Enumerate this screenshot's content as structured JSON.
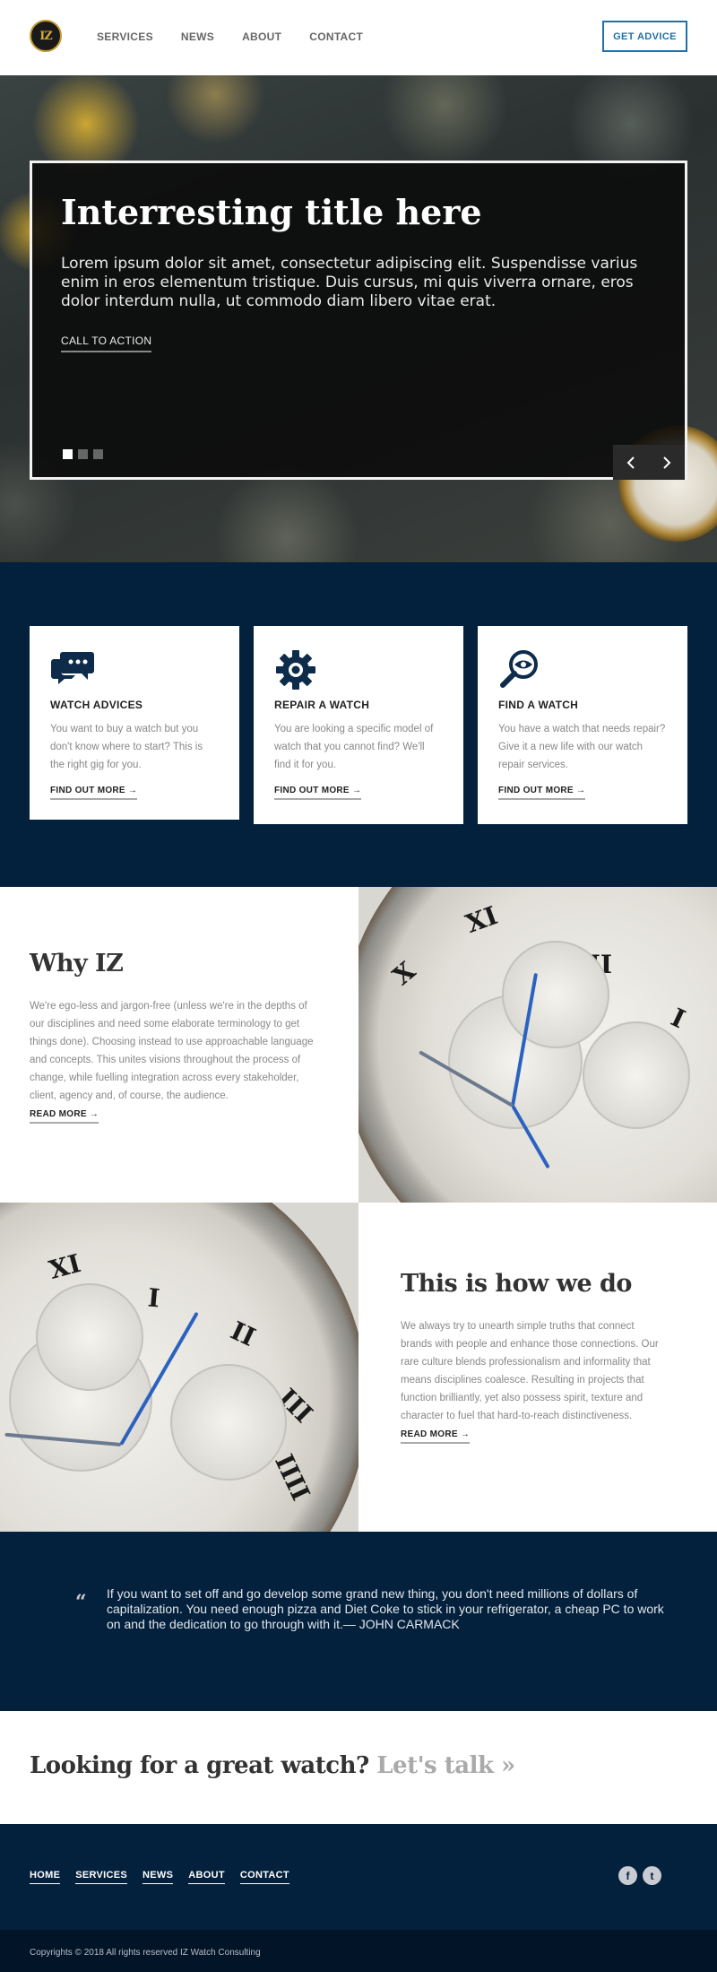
{
  "header": {
    "logo_text": "IZ",
    "nav": [
      "SERVICES",
      "NEWS",
      "ABOUT",
      "CONTACT"
    ],
    "cta": "GET ADVICE"
  },
  "hero": {
    "title": "Interresting title here",
    "text": "Lorem ipsum dolor sit amet, consectetur adipiscing elit. Suspendisse varius enim in eros elementum tristique. Duis cursus, mi quis viverra ornare, eros dolor interdum nulla, ut commodo diam libero vitae erat.",
    "cta": "CALL TO ACTION",
    "slides_total": 3,
    "active_slide": 1,
    "prev_icon": "chevron-left-icon",
    "next_icon": "chevron-right-icon"
  },
  "services": [
    {
      "icon": "chat-bubble-icon",
      "title": "WATCH ADVICES",
      "text": "You want to buy a watch but you don't know where to start? This is the right gig for you.",
      "link": "FIND OUT MORE →"
    },
    {
      "icon": "gear-icon",
      "title": "REPAIR A WATCH",
      "text": "You are looking a specific model of watch that you cannot find? We'll find it for you.",
      "link": "FIND OUT MORE →"
    },
    {
      "icon": "magnifier-eye-icon",
      "title": "FIND A WATCH",
      "text": "You have a watch that needs repair? Give it a new life with our watch repair services.",
      "link": "FIND OUT MORE →"
    }
  ],
  "why": {
    "title": "Why IZ",
    "text": "We're ego-less and jargon-free (unless we're in the depths of our disciplines and need some elaborate terminology to get things done). Choosing instead to use approachable language and concepts. This unites visions throughout the process of change, while fuelling integration across every stakeholder, client, agency and, of course, the audience.",
    "link": "READ MORE →"
  },
  "how": {
    "title": "This is how we do",
    "text": "We always try to unearth simple truths that connect brands with people and enhance those connections. Our rare culture blends professionalism and informality that means disciplines coalesce. Resulting in projects that function brilliantly, yet also possess spirit, texture and character to fuel that hard-to-reach distinctiveness.",
    "link": "READ MORE →"
  },
  "quote": {
    "mark": "“",
    "text": "If you want to set off and go develop some grand new thing, you don't need millions of dollars of capitalization. You need enough pizza and Diet Coke to stick in your refrigerator, a cheap PC to work on and the dedication to go through with it.— JOHN CARMACK"
  },
  "talk": {
    "lead": "Looking for a great watch?",
    "link": "Let's talk »"
  },
  "footer": {
    "nav": [
      "HOME",
      "SERVICES",
      "NEWS",
      "ABOUT",
      "CONTACT"
    ],
    "social": [
      {
        "icon": "facebook-icon",
        "glyph": "f"
      },
      {
        "icon": "twitter-icon",
        "glyph": "t"
      }
    ],
    "copyright": "Copyrights © 2018 All rights reserved IZ Watch Consulting"
  },
  "colors": {
    "navy": "#03213d",
    "accent_blue": "#2270a8",
    "gold": "#c59a2e"
  }
}
